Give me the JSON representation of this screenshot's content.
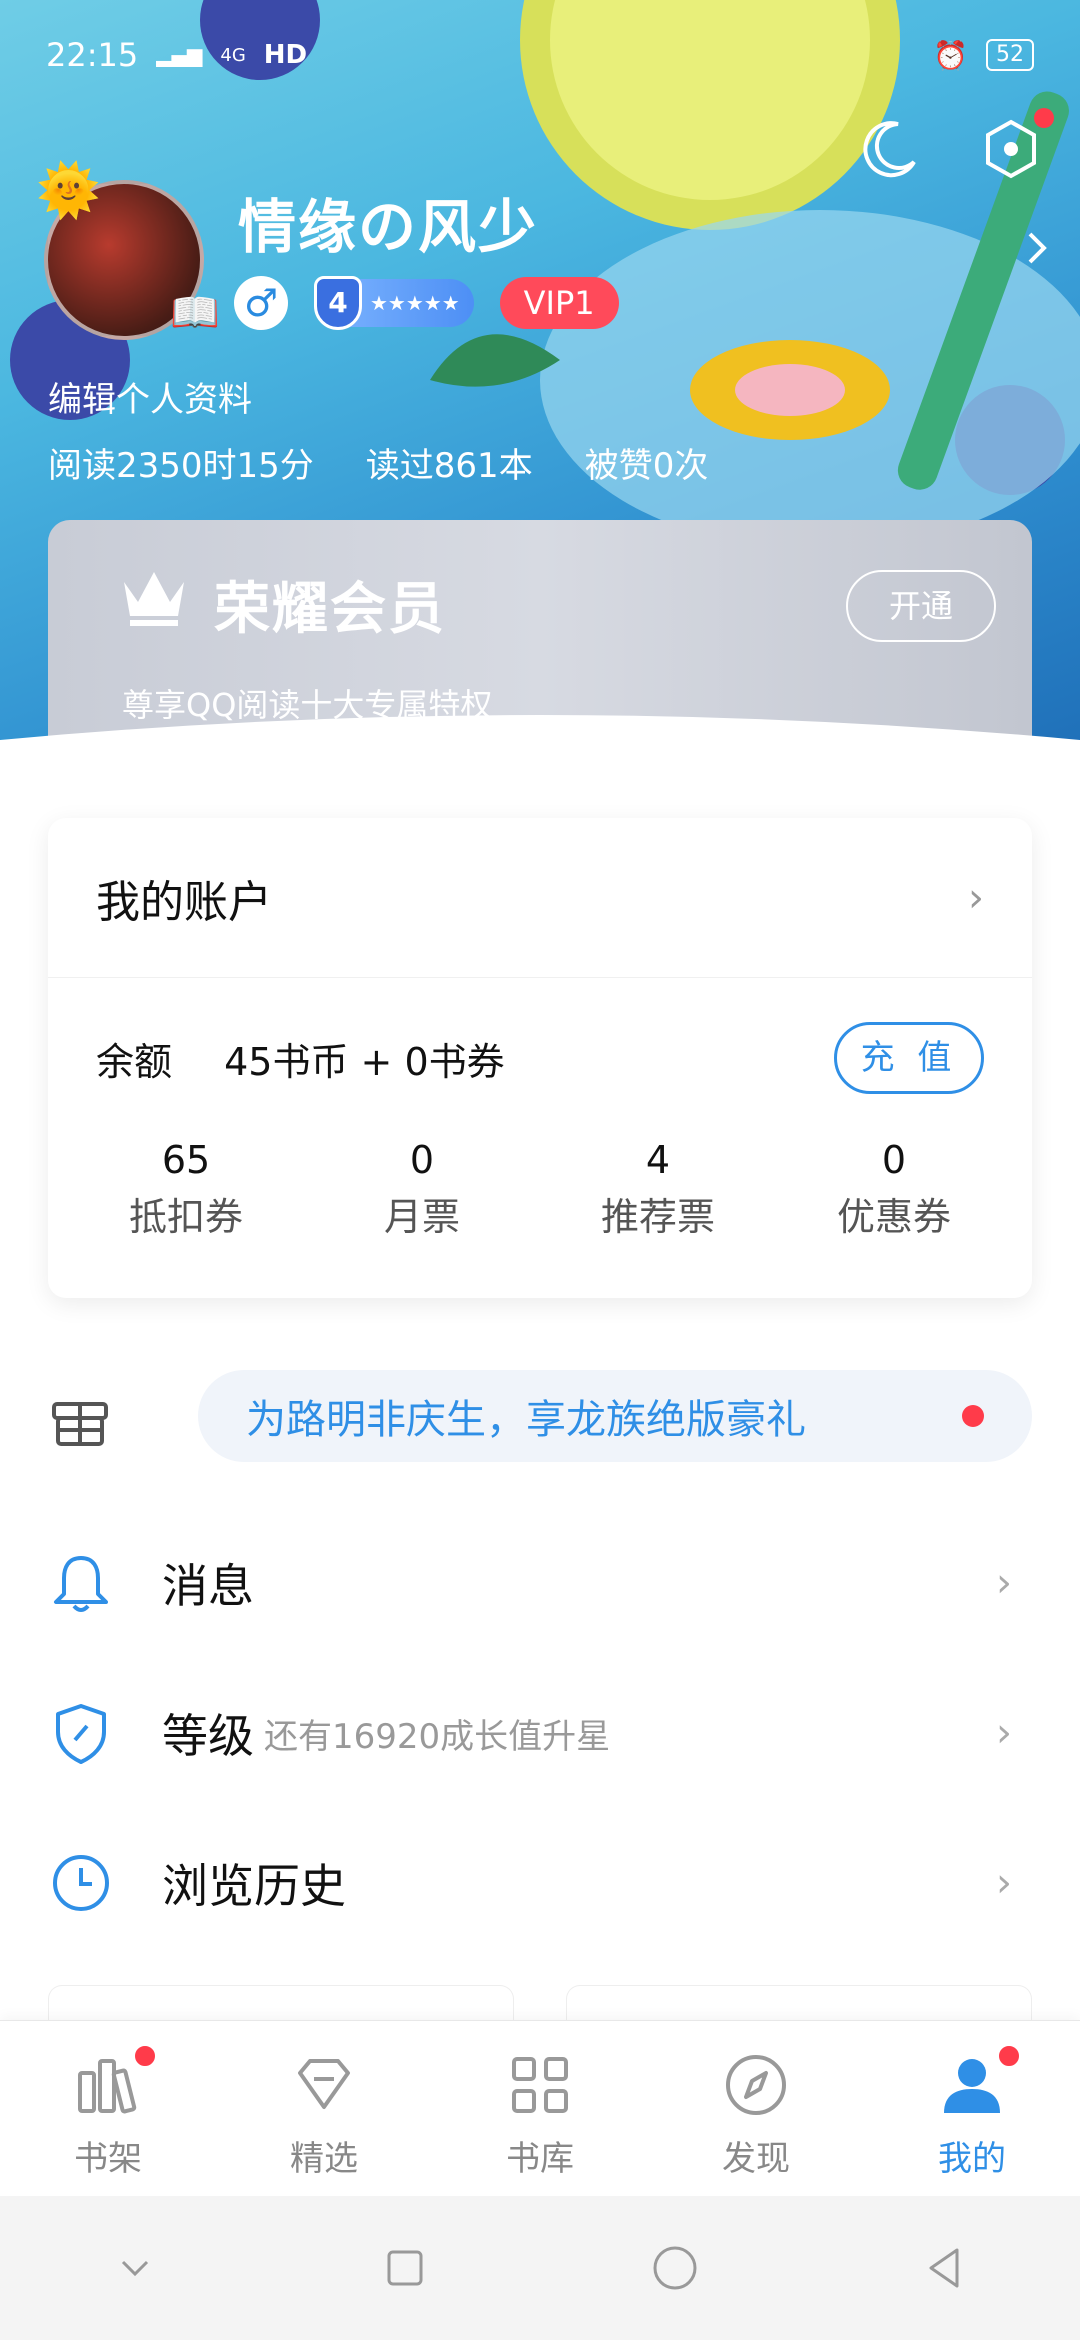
{
  "status": {
    "time": "22:15",
    "network": "4G",
    "hd": "HD",
    "battery": "52"
  },
  "profile": {
    "nickname": "情缘の风少",
    "gender_symbol": "♂",
    "level": "4",
    "level_stars": "★★★★★",
    "vip": "VIP1",
    "edit": "编辑个人资料",
    "read_time": "阅读2350时15分",
    "books_read": "读过861本",
    "likes": "被赞0次"
  },
  "vip_card": {
    "title": "荣耀会员",
    "subtitle": "尊享QQ阅读十大专属特权",
    "open": "开通"
  },
  "account": {
    "title": "我的账户",
    "balance_label": "余额",
    "balance_value": "45书币 + 0书券",
    "recharge": "充 值",
    "tickets": [
      {
        "num": "65",
        "label": "抵扣券"
      },
      {
        "num": "0",
        "label": "月票"
      },
      {
        "num": "4",
        "label": "推荐票"
      },
      {
        "num": "0",
        "label": "优惠券"
      }
    ]
  },
  "promo": {
    "text": "为路明非庆生，享龙族绝版豪礼"
  },
  "menu": [
    {
      "label": "消息",
      "sub": ""
    },
    {
      "label": "等级",
      "sub": "还有16920成长值升星"
    },
    {
      "label": "浏览历史",
      "sub": ""
    }
  ],
  "nav": [
    {
      "label": "书架",
      "icon": "bookshelf-icon",
      "badge": true
    },
    {
      "label": "精选",
      "icon": "diamond-icon",
      "badge": false
    },
    {
      "label": "书库",
      "icon": "grid-icon",
      "badge": false
    },
    {
      "label": "发现",
      "icon": "compass-icon",
      "badge": false
    },
    {
      "label": "我的",
      "icon": "user-icon",
      "badge": true,
      "active": true
    }
  ],
  "colors": {
    "accent": "#2f8fe6",
    "alert": "#ff3b4a",
    "vip": "#ff4a5a"
  }
}
